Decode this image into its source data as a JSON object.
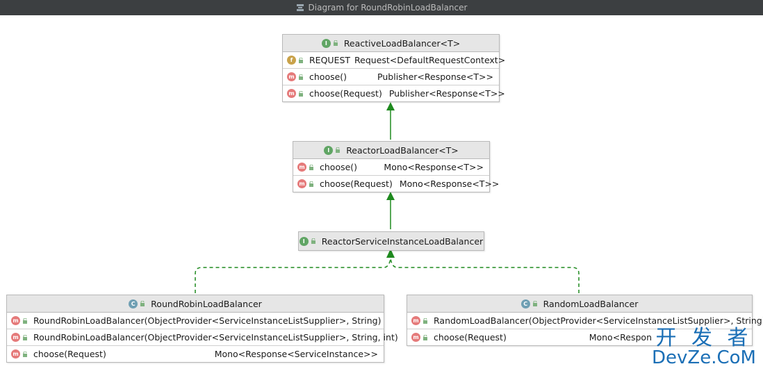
{
  "window": {
    "title": "Diagram for RoundRobinLoadBalancer"
  },
  "colors": {
    "interface_badge": "#60a564",
    "class_badge": "#6f9fb3",
    "method_badge": "#e57a7a",
    "edge": "#1f8a1f",
    "watermark": "#1b6fb6"
  },
  "nodes": {
    "reactive": {
      "name": "ReactiveLoadBalancer<T>",
      "kind": "interface",
      "rows": [
        {
          "icon": "field-icon",
          "name": "REQUEST",
          "type": "Request<DefaultRequestContext>"
        },
        {
          "icon": "method-icon",
          "name": "choose()",
          "type": "Publisher<Response<T>>"
        },
        {
          "icon": "method-icon",
          "name": "choose(Request)",
          "type": "Publisher<Response<T>>"
        }
      ]
    },
    "reactor": {
      "name": "ReactorLoadBalancer<T>",
      "kind": "interface",
      "rows": [
        {
          "icon": "method-icon",
          "name": "choose()",
          "type": "Mono<Response<T>>"
        },
        {
          "icon": "method-icon",
          "name": "choose(Request)",
          "type": "Mono<Response<T>>"
        }
      ]
    },
    "service": {
      "name": "ReactorServiceInstanceLoadBalancer",
      "kind": "interface",
      "rows": []
    },
    "roundrobin": {
      "name": "RoundRobinLoadBalancer",
      "kind": "class",
      "rows": [
        {
          "icon": "method-icon",
          "name": "RoundRobinLoadBalancer(ObjectProvider<ServiceInstanceListSupplier>, String)",
          "type": ""
        },
        {
          "icon": "method-icon",
          "name": "RoundRobinLoadBalancer(ObjectProvider<ServiceInstanceListSupplier>, String, int)",
          "type": ""
        },
        {
          "icon": "method-icon",
          "name": "choose(Request)",
          "type": "Mono<Response<ServiceInstance>>"
        }
      ]
    },
    "random": {
      "name": "RandomLoadBalancer",
      "kind": "class",
      "rows": [
        {
          "icon": "method-icon",
          "name": "RandomLoadBalancer(ObjectProvider<ServiceInstanceListSupplier>, String)",
          "type": ""
        },
        {
          "icon": "method-icon",
          "name": "choose(Request)",
          "type": "Mono<Respon"
        }
      ]
    }
  },
  "watermark": {
    "line1": "开 发 者",
    "line2": "DevZe.CoM"
  }
}
